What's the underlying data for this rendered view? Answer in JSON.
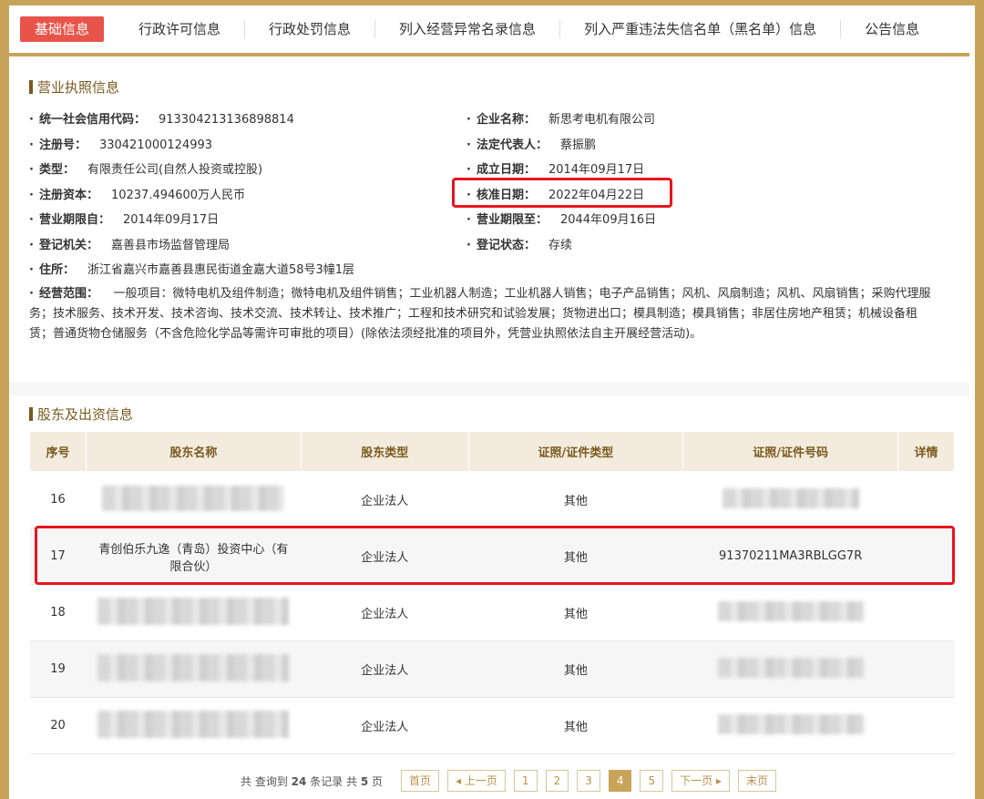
{
  "tabs": [
    "基础信息",
    "行政许可信息",
    "行政处罚信息",
    "列入经营异常名录信息",
    "列入严重违法失信名单（黑名单）信息",
    "公告信息"
  ],
  "license": {
    "title": "营业执照信息",
    "credit_code_label": "统一社会信用代码：",
    "credit_code": "913304213136898814",
    "company_name_label": "企业名称：",
    "company_name": "新思考电机有限公司",
    "reg_no_label": "注册号：",
    "reg_no": "330421000124993",
    "legal_rep_label": "法定代表人：",
    "legal_rep": "蔡振鹏",
    "type_label": "类型：",
    "type": "有限责任公司(自然人投资或控股)",
    "est_date_label": "成立日期：",
    "est_date": "2014年09月17日",
    "capital_label": "注册资本：",
    "capital": "10237.494600万人民币",
    "approve_date_label": "核准日期：",
    "approve_date": "2022年04月22日",
    "term_from_label": "营业期限自：",
    "term_from": "2014年09月17日",
    "term_to_label": "营业期限至：",
    "term_to": "2044年09月16日",
    "authority_label": "登记机关：",
    "authority": "嘉善县市场监督管理局",
    "status_label": "登记状态：",
    "status": "存续",
    "address_label": "住所：",
    "address": "浙江省嘉兴市嘉善县惠民街道金嘉大道58号3幢1层",
    "scope_label": "经营范围：",
    "scope": "一般项目：微特电机及组件制造；微特电机及组件销售；工业机器人制造；工业机器人销售；电子产品销售；风机、风扇制造；风机、风扇销售；采购代理服务；技术服务、技术开发、技术咨询、技术交流、技术转让、技术推广；工程和技术研究和试验发展；货物进出口；模具制造；模具销售；非居住房地产租赁；机械设备租赁；普通货物仓储服务（不含危险化学品等需许可审批的项目）(除依法须经批准的项目外，凭营业执照依法自主开展经营活动)。"
  },
  "shareholders": {
    "title": "股东及出资信息",
    "headers": [
      "序号",
      "股东名称",
      "股东类型",
      "证照/证件类型",
      "证照/证件号码",
      "详情"
    ],
    "rows": [
      {
        "no": "16",
        "name": "",
        "type": "企业法人",
        "cert_type": "其他",
        "cert_no": ""
      },
      {
        "no": "17",
        "name": "青创伯乐九逸（青岛）投资中心（有限合伙）",
        "type": "企业法人",
        "cert_type": "其他",
        "cert_no": "91370211MA3RBLGG7R"
      },
      {
        "no": "18",
        "name": "",
        "type": "企业法人",
        "cert_type": "其他",
        "cert_no": ""
      },
      {
        "no": "19",
        "name": "",
        "type": "企业法人",
        "cert_type": "其他",
        "cert_no": ""
      },
      {
        "no": "20",
        "name": "",
        "type": "企业法人",
        "cert_type": "其他",
        "cert_no": ""
      }
    ]
  },
  "pager": {
    "prefix": "共 查询到",
    "total": "24",
    "mid": "条记录 共",
    "pages": "5",
    "suffix": "页",
    "first": "首页",
    "prev": "◂ 上一页",
    "p1": "1",
    "p2": "2",
    "p3": "3",
    "p4": "4",
    "p5": "5",
    "next": "下一页 ▸",
    "last": "末页"
  }
}
